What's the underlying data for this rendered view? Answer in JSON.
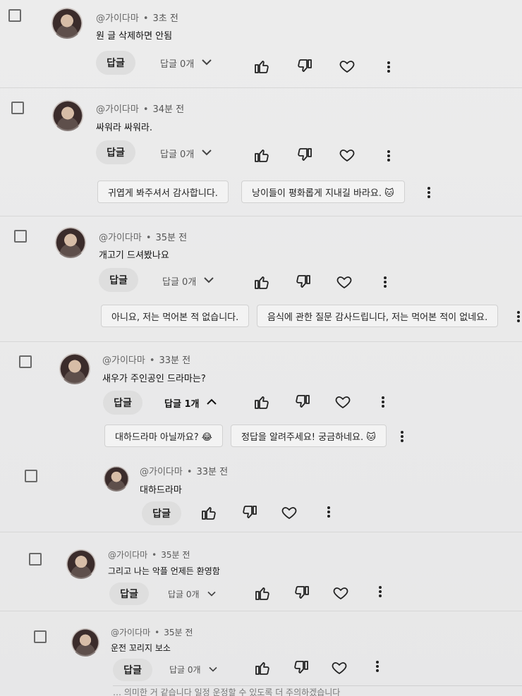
{
  "comments": [
    {
      "id": "c1",
      "handle": "@가이다마",
      "time": "3초 전",
      "text": "원 글 삭제하면 안됨",
      "reply_label": "답글",
      "replies_label": "답글 0개",
      "replies_open": false
    },
    {
      "id": "c2",
      "handle": "@가이다마",
      "time": "34분 전",
      "text": "싸워라 싸워라.",
      "reply_label": "답글",
      "replies_label": "답글 0개",
      "replies_open": false,
      "suggestions": [
        "귀엽게 봐주셔서 감사합니다.",
        "낭이들이 평화롭게 지내길 바라요. 🐱"
      ]
    },
    {
      "id": "c3",
      "handle": "@가이다마",
      "time": "35분 전",
      "text": "개고기 드셔봤나요",
      "reply_label": "답글",
      "replies_label": "답글 0개",
      "replies_open": false,
      "suggestions": [
        "아니요, 저는 먹어본 적 없습니다.",
        "음식에 관한 질문 감사드립니다, 저는 먹어본 적이 없네요."
      ]
    },
    {
      "id": "c4",
      "handle": "@가이다마",
      "time": "33분 전",
      "text": "새우가 주인공인 드라마는?",
      "reply_label": "답글",
      "replies_label": "답글 1개",
      "replies_open": true,
      "suggestions": [
        "대하드라마 아닐까요? 😂",
        "정답을 알려주세요! 궁금하네요. 🐱"
      ]
    },
    {
      "id": "c5",
      "handle": "@가이다마",
      "time": "33분 전",
      "text": "대하드라마",
      "reply_label": "답글",
      "is_reply": true
    },
    {
      "id": "c6",
      "handle": "@가이다마",
      "time": "35분 전",
      "text": "그리고 나는 악플 언제든 환영함",
      "reply_label": "답글",
      "replies_label": "답글 0개",
      "replies_open": false
    },
    {
      "id": "c7",
      "handle": "@가이다마",
      "time": "35분 전",
      "text": "운전 꼬리지 보소",
      "reply_label": "답글",
      "replies_label": "답글 0개",
      "replies_open": false
    }
  ],
  "bottom_partial_text": "… 의미한 거 같습니다     일정 운정할 수 있도록 더 주의하겠습니다",
  "colors": {
    "text": "#111111",
    "meta": "#666666",
    "reply_btn": "#dedede",
    "chip_border": "#d1d1d1"
  }
}
